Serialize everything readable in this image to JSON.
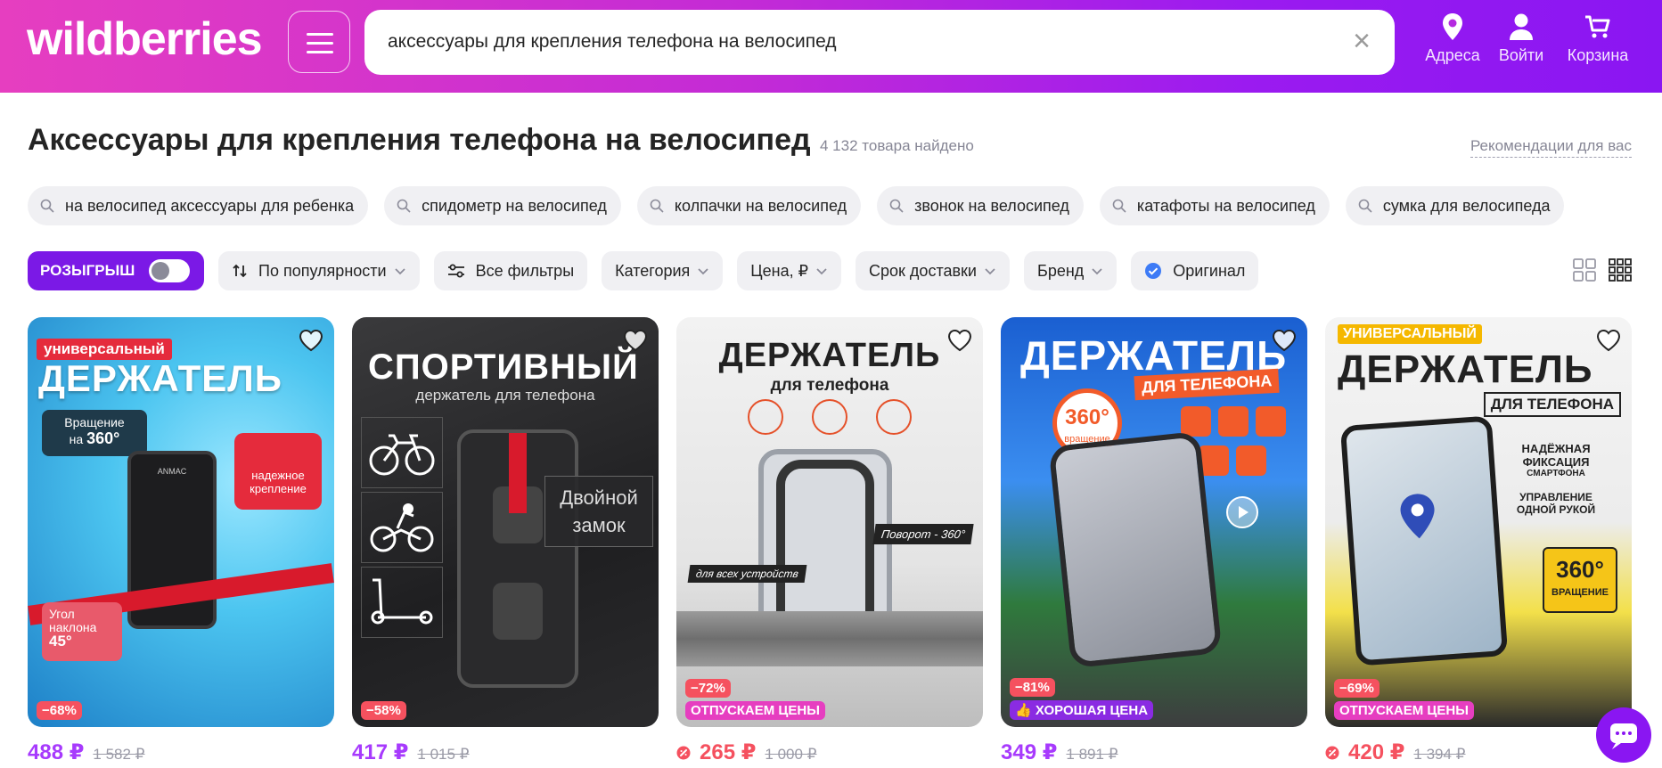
{
  "header": {
    "logo": "wildberries",
    "search_value": "аксессуары для крепления телефона на велосипед",
    "nav": [
      {
        "label": "Адреса",
        "icon": "location-pin-icon"
      },
      {
        "label": "Войти",
        "icon": "user-icon"
      },
      {
        "label": "Корзина",
        "icon": "cart-icon"
      }
    ]
  },
  "page": {
    "title": "Аксессуары для крепления телефона на велосипед",
    "count": "4 132 товара найдено",
    "recommendations": "Рекомендации для вас"
  },
  "chips": [
    "на велосипед аксессуары для ребенка",
    "спидометр на велосипед",
    "колпачки на велосипед",
    "звонок на велосипед",
    "катафоты на велосипед",
    "сумка для велосипеда"
  ],
  "filters": {
    "promo": "РОЗЫГРЫШ",
    "sort": "По популярности",
    "all": "Все фильтры",
    "category": "Категория",
    "price": "Цена, ₽",
    "delivery": "Срок доставки",
    "brand": "Бренд",
    "original": "Оригинал"
  },
  "products": [
    {
      "discount": "−68%",
      "deal": "",
      "price": "488 ₽",
      "old_price": "1 582 ₽",
      "price_color": "purple",
      "img": {
        "tag": "универсальный",
        "big": "ДЕРЖАТЕЛЬ",
        "rot_a": "Вращение",
        "rot_b": "на",
        "rot_c": "360°",
        "rel_a": "надежное",
        "rel_b": "крепление",
        "tilt_a": "Угол",
        "tilt_b": "наклона",
        "tilt_c": "45°",
        "brand": "ANMAC"
      }
    },
    {
      "discount": "−58%",
      "deal": "",
      "price": "417 ₽",
      "old_price": "1 015 ₽",
      "price_color": "purple",
      "img": {
        "big": "СПОРТИВНЫЙ",
        "sub": "держатель для телефона",
        "lock_a": "Двойной",
        "lock_b": "замок"
      }
    },
    {
      "discount": "−72%",
      "deal": "ОТПУСКАЕМ ЦЕНЫ",
      "price": "265 ₽",
      "old_price": "1 000 ₽",
      "price_color": "red",
      "img": {
        "big": "ДЕРЖАТЕЛЬ",
        "sub": "для телефона",
        "rot": "Поворот - 360°",
        "all": "для всех устройств"
      }
    },
    {
      "discount": "−81%",
      "deal": "ХОРОШАЯ ЦЕНА",
      "price": "349 ₽",
      "old_price": "1 891 ₽",
      "price_color": "purple",
      "img": {
        "big": "ДЕРЖАТЕЛЬ",
        "sub": "ДЛЯ ТЕЛЕФОНА",
        "circle_a": "360°",
        "circle_b": "вращение"
      }
    },
    {
      "discount": "−69%",
      "deal": "ОТПУСКАЕМ ЦЕНЫ",
      "price": "420 ₽",
      "old_price": "1 394 ₽",
      "price_color": "red",
      "img": {
        "tag": "УНИВЕРСАЛЬНЫЙ",
        "big": "ДЕРЖАТЕЛЬ",
        "sub": "ДЛЯ ТЕЛЕФОНА",
        "f1a": "НАДЁЖНАЯ ФИКСАЦИЯ",
        "f1b": "СМАРТФОНА",
        "f2a": "УПРАВЛЕНИЕ",
        "f2b": "ОДНОЙ РУКОЙ",
        "r_a": "360°",
        "r_b": "ВРАЩЕНИЕ"
      }
    }
  ]
}
